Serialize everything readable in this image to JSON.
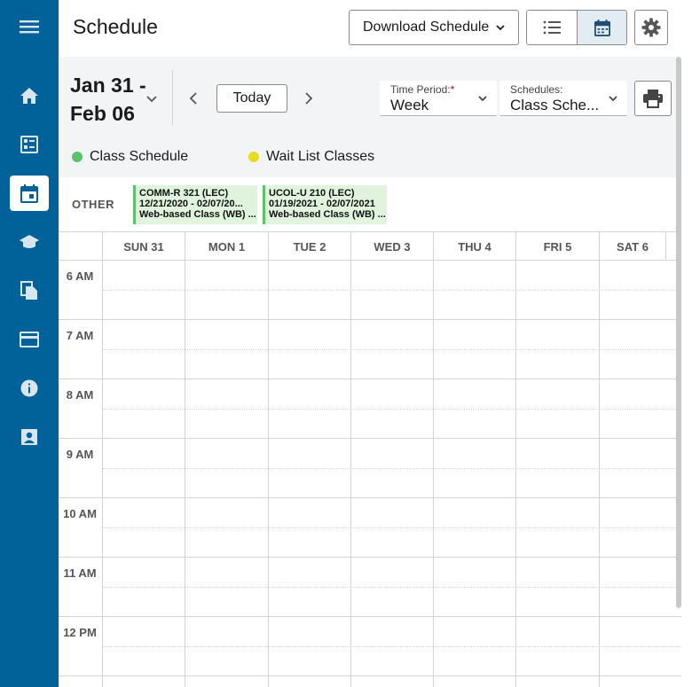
{
  "sidebar": {
    "items": [
      {
        "icon": "menu-icon"
      },
      {
        "icon": "home-icon"
      },
      {
        "icon": "dashboard-icon"
      },
      {
        "icon": "calendar-icon",
        "active": true
      },
      {
        "icon": "graduation-cap-icon"
      },
      {
        "icon": "documents-icon"
      },
      {
        "icon": "credit-card-icon"
      },
      {
        "icon": "info-icon"
      },
      {
        "icon": "profile-icon"
      }
    ],
    "color": "#006298"
  },
  "header": {
    "title": "Schedule",
    "download_label": "Download Schedule"
  },
  "toolbar": {
    "date_range_line1": "Jan 31 -",
    "date_range_line2": "Feb 06",
    "today_label": "Today",
    "time_period": {
      "label": "Time Period:",
      "required_mark": "*",
      "value": "Week"
    },
    "schedules": {
      "label": "Schedules:",
      "value": "Class Sche..."
    }
  },
  "legend": {
    "class_schedule": {
      "label": "Class Schedule",
      "color": "#5cc16a"
    },
    "wait_list": {
      "label": "Wait List Classes",
      "color": "#e5dc1c"
    }
  },
  "other": {
    "label": "OTHER",
    "courses": [
      {
        "code": "COMM-R 321 (LEC)",
        "dates": "12/21/2020 - 02/07/20...",
        "mode": "Web-based Class (WB) ..."
      },
      {
        "code": "UCOL-U 210 (LEC)",
        "dates": "01/19/2021 - 02/07/2021",
        "mode": "Web-based Class (WB) ..."
      }
    ]
  },
  "calendar": {
    "days": [
      "SUN 31",
      "MON 1",
      "TUE 2",
      "WED 3",
      "THU 4",
      "FRI 5",
      "SAT 6"
    ],
    "times": [
      "6 AM",
      "7 AM",
      "8 AM",
      "9 AM",
      "10 AM",
      "11 AM",
      "12 PM"
    ]
  }
}
